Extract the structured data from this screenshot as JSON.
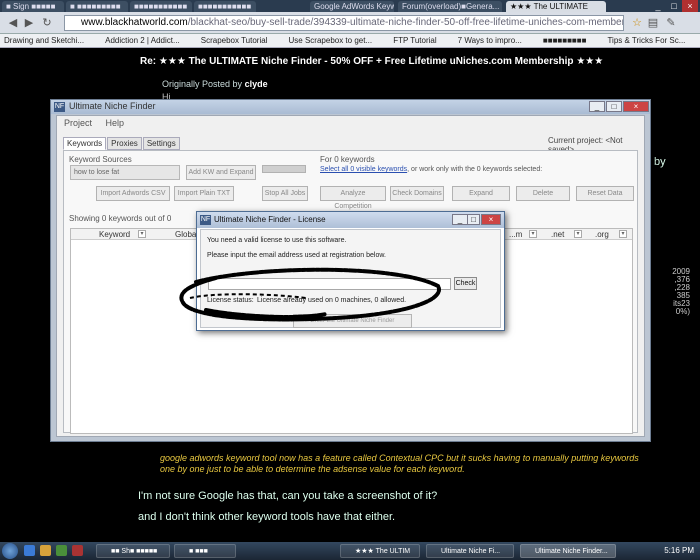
{
  "browser": {
    "tabs": [
      {
        "label": "■ Sign ■■■■■"
      },
      {
        "label": "■ ■■■■■■■■■"
      },
      {
        "label": "■■■■■■■■■■■"
      },
      {
        "label": "■■■■■■■■■■■"
      },
      {
        "label": "Google AdWords Keywo..."
      },
      {
        "label": "Forum(overload)■Genera..."
      },
      {
        "label": "★★★ The ULTIMATE"
      }
    ],
    "url_domain": "www.blackhatworld.com",
    "url_path": "/blackhat-seo/buy-sell-trade/394339-ultimate-niche-finder-50-off-free-lifetime-uniches-com-membership-25.html",
    "bookmarks": [
      "Drawing and Sketchi...",
      "Addiction 2 | Addict...",
      "Scrapebox Tutorial",
      "Use Scrapebox to get...",
      "FTP Tutorial",
      "7 Ways to impro...",
      "■■■■■■■■■",
      "Tips & Tricks For Sc..."
    ]
  },
  "forum": {
    "post_title": "Re: ★★★ The ULTIMATE Niche Finder - 50% OFF + Free Lifetime uNiches.com Membership ★★★",
    "quote_prefix": "Originally Posted by",
    "quote_author": "clyde",
    "quote_start": "Hi,",
    "quoted_text": "google adwords keyword tool now has a feature called Contextual CPC but it sucks having to manually putting keywords one by one just to be able to determine the adsense value for each keyword.",
    "reply_line1": "I'm not sure Google has that, can you take a screenshot of it?",
    "reply_line2": "and I don't think other keyword tools have that either.",
    "side_by": "by",
    "side_numbers": [
      "2009",
      ",376",
      ",228",
      "385",
      "its23",
      "0%)"
    ]
  },
  "app": {
    "title": "Ultimate Niche Finder",
    "menu": [
      "Project",
      "Help"
    ],
    "tabs": [
      "Keywords",
      "Proxies",
      "Settings"
    ],
    "current_project_label": "Current project:",
    "current_project_value": "<Not saved>",
    "keyword_sources_label": "Keyword Sources",
    "seed_keyword": "how to lose fat",
    "add_kw_btn": "Add KW and Expand",
    "import_csv_btn": "Import Adwords CSV",
    "import_txt_btn": "Import Plain TXT",
    "stop_btn": "Stop All Jobs",
    "for_keywords_label": "For 0 keywords",
    "select_link": "Select all 0 visible keywords",
    "select_suffix": ", or work only with the 0 keywords selected:",
    "analyze_btn": "Analyze Competition",
    "check_domains_btn": "Check Domains",
    "expand_btn": "Expand",
    "delete_btn": "Delete",
    "reset_btn": "Reset Data",
    "showing_label": "Showing 0 keywords out of 0",
    "columns": [
      "Keyword",
      "Global",
      "...m",
      ".net",
      ".org"
    ]
  },
  "dialog": {
    "title": "Ultimate Niche Finder - License",
    "line1": "You need a valid license to use this software.",
    "line2": "Please input the email address used at registration below.",
    "email_value": "",
    "check_btn": "Check",
    "status_label": "License status:",
    "status_value": "License already used on 0 machines, 0 allowed.",
    "enter_btn": "Enter the Ultimate Niche Finder"
  },
  "taskbar": {
    "items": [
      "■■ Sh■ ■■■■■",
      "■ ■■■",
      "★★★ The ULTIM",
      "Ultimate Niche Fi...",
      "Ultimate Niche Finder..."
    ],
    "clock": "5:16 PM"
  }
}
